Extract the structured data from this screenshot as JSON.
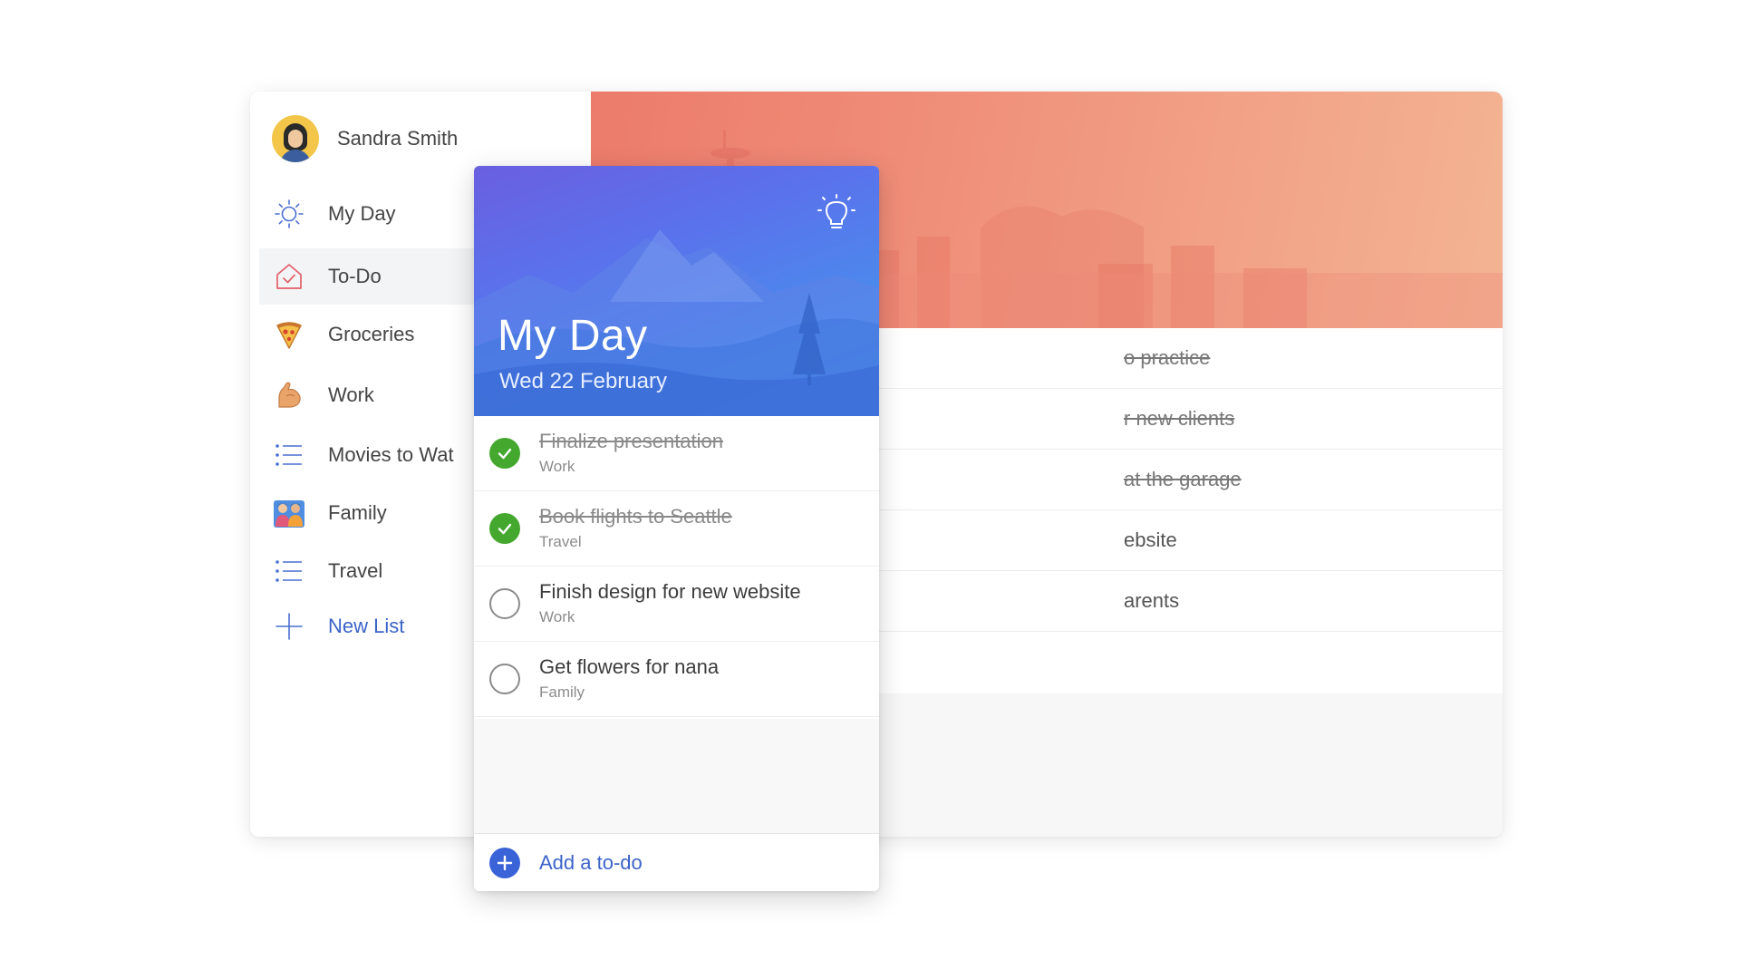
{
  "profile": {
    "name": "Sandra Smith",
    "avatar_icon": "person-avatar-icon"
  },
  "sidebar": {
    "items": [
      {
        "label": "My Day",
        "icon": "sun-icon"
      },
      {
        "label": "To-Do",
        "icon": "house-check-icon",
        "active": true
      },
      {
        "label": "Groceries",
        "icon": "pizza-icon"
      },
      {
        "label": "Work",
        "icon": "flexed-arm-icon"
      },
      {
        "label": "Movies to Wat",
        "icon": "list-icon"
      },
      {
        "label": "Family",
        "icon": "family-icon"
      },
      {
        "label": "Travel",
        "icon": "list-icon"
      },
      {
        "label": "New List",
        "icon": "plus-icon"
      }
    ]
  },
  "background_list": {
    "rows": [
      {
        "text": "o practice",
        "completed": true
      },
      {
        "text": "r new clients",
        "completed": true
      },
      {
        "text": "at the garage",
        "completed": true
      },
      {
        "text": "ebsite",
        "completed": false
      },
      {
        "text": "arents",
        "completed": false
      }
    ]
  },
  "my_day": {
    "title": "My Day",
    "date": "Wed 22 February",
    "suggestions_icon": "lightbulb-icon",
    "tasks": [
      {
        "title": "Finalize presentation",
        "list": "Work",
        "completed": true
      },
      {
        "title": "Book flights to Seattle",
        "list": "Travel",
        "completed": true
      },
      {
        "title": "Finish design for new website",
        "list": "Work",
        "completed": false
      },
      {
        "title": "Get flowers for nana",
        "list": "Family",
        "completed": false
      }
    ],
    "add_label": "Add a to-do"
  },
  "colors": {
    "accent_blue": "#3b63c8",
    "complete_green": "#43a82d",
    "header_gradient_start": "#6a5fe0",
    "header_gradient_end": "#3f97ea",
    "hero_gradient_start": "#ec7b6b",
    "hero_gradient_end": "#f3b493"
  }
}
